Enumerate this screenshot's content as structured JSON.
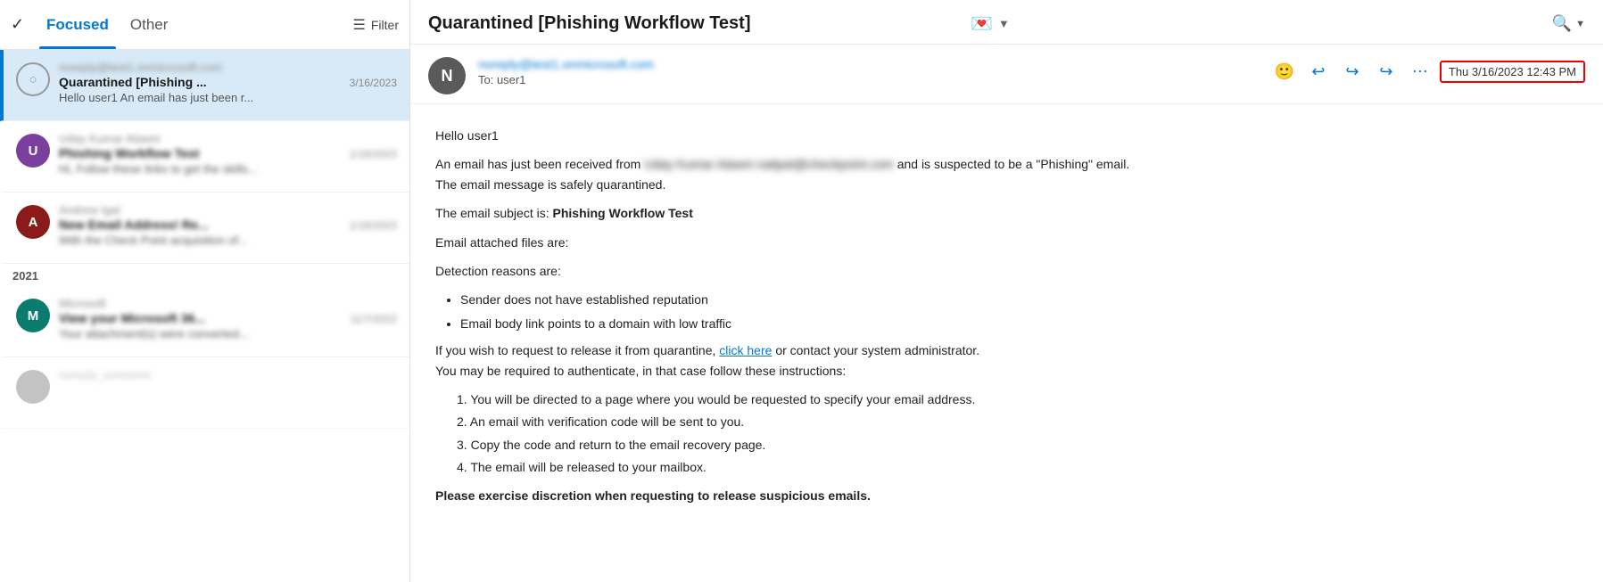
{
  "leftPanel": {
    "tabs": [
      {
        "id": "focused",
        "label": "Focused",
        "active": true
      },
      {
        "id": "other",
        "label": "Other",
        "active": false
      }
    ],
    "filterLabel": "Filter",
    "emails": [
      {
        "id": 1,
        "selected": true,
        "avatarType": "circle-outline",
        "avatarLetter": "",
        "senderBlurred": true,
        "sender": "noreply@test1.onmicrosoft.com",
        "subject": "Quarantined [Phishing ...",
        "date": "3/16/2023",
        "preview": "Hello user1 An email has just been r...",
        "previewBlurred": false
      },
      {
        "id": 2,
        "selected": false,
        "avatarType": "purple",
        "avatarLetter": "U",
        "senderBlurred": true,
        "sender": "Uday Kumar Alawni",
        "subject": "Phishing Workflow Test",
        "date": "1/16/2023",
        "dateBlurred": true,
        "preview": "Hi, Follow these links to get the skills...",
        "previewBlurred": true
      },
      {
        "id": 3,
        "selected": false,
        "avatarType": "darkred",
        "avatarLetter": "A",
        "senderBlurred": true,
        "sender": "Andrew Igal",
        "subject": "New Email Address! Re...",
        "date": "1/16/2023",
        "dateBlurred": true,
        "preview": "With the Check Point acquisition of...",
        "previewBlurred": true
      },
      {
        "id": "year",
        "type": "divider",
        "label": "2021"
      },
      {
        "id": 4,
        "selected": false,
        "avatarType": "teal",
        "avatarLetter": "M",
        "senderBlurred": true,
        "sender": "Microsoft",
        "subject": "View your Microsoft 36...",
        "date": "11/7/2022",
        "dateBlurred": true,
        "preview": "Your attachment(s) were converted...",
        "previewBlurred": true,
        "hasAttachment": true
      }
    ]
  },
  "rightPanel": {
    "title": "Quarantined [Phishing Workflow Test]",
    "senderEmail": "noreply@test1.onmicrosoft.com",
    "senderAvatarLetter": "N",
    "toLine": "To: user1",
    "timestamp": "Thu 3/16/2023 12:43 PM",
    "body": {
      "greeting": "Hello user1",
      "intro": "An email has just been received from",
      "introSenderBlurred": "[blurred sender name and email]",
      "introSuffix": "and is suspected to be a \"Phishing\" email.",
      "quarantineNote": "The email message is safely quarantined.",
      "subjectLine": "The email subject is:",
      "subjectBold": "Phishing Workflow Test",
      "attachedLine": "Email attached files are:",
      "detectionLine": "Detection reasons are:",
      "bullets": [
        "Sender does not have established reputation",
        "Email body link points to a domain with low traffic"
      ],
      "releaseText1": "If you wish to request to release it from quarantine,",
      "clickHereLabel": "click here",
      "releaseText2": "or contact your system administrator.",
      "authNote": "You may be required to authenticate, in that case follow these instructions:",
      "steps": [
        "1. You will be directed to a page where you would be requested to specify your email address.",
        "2. An email with verification code will be sent to you.",
        "3. Copy the code and return to the email recovery page.",
        "4. The email will be released to your mailbox."
      ],
      "disclaimer": "Please exercise discretion when requesting to release suspicious emails."
    },
    "toolbar": {
      "emojiLabel": "😊",
      "replyLabel": "↩",
      "replyAllLabel": "↩",
      "forwardLabel": "↪",
      "moreLabel": "⋯"
    }
  }
}
